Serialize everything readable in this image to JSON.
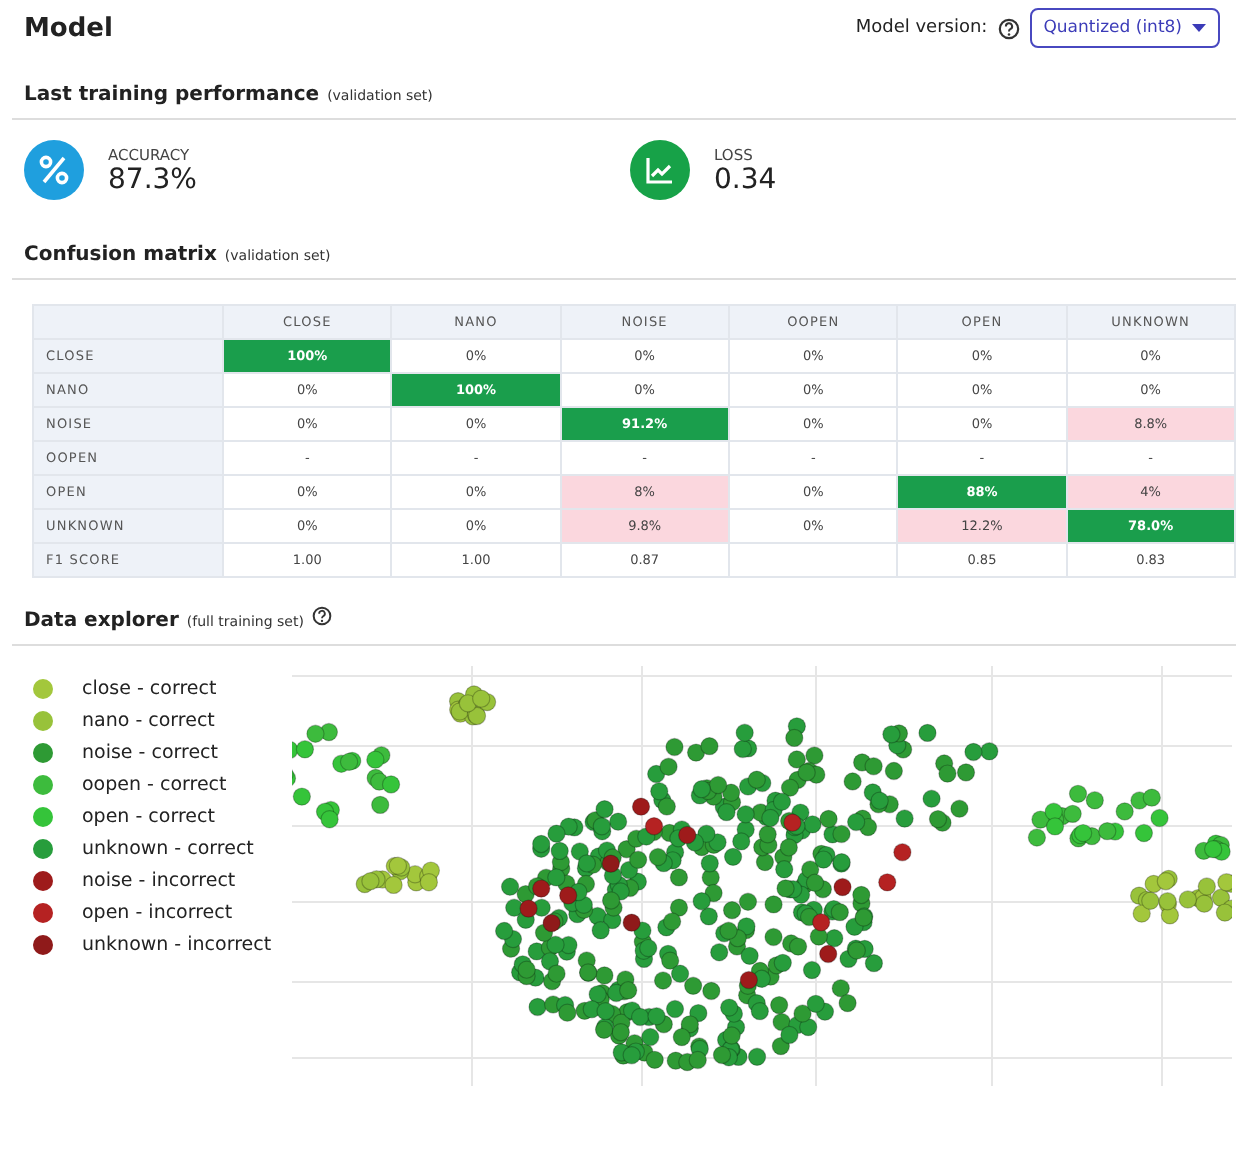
{
  "header": {
    "title": "Model",
    "version_label": "Model version:",
    "version_value": "Quantized (int8)"
  },
  "performance": {
    "title": "Last training performance",
    "subtitle": "(validation set)",
    "metrics": [
      {
        "kind": "accuracy",
        "label": "ACCURACY",
        "value": "87.3%"
      },
      {
        "kind": "loss",
        "label": "LOSS",
        "value": "0.34"
      }
    ]
  },
  "confusion": {
    "title": "Confusion matrix",
    "subtitle": "(validation set)",
    "columns": [
      "CLOSE",
      "NANO",
      "NOISE",
      "OOPEN",
      "OPEN",
      "UNKNOWN"
    ],
    "rows": [
      {
        "label": "CLOSE",
        "cells": [
          {
            "text": "100%",
            "kind": "correct"
          },
          {
            "text": "0%",
            "kind": "plain"
          },
          {
            "text": "0%",
            "kind": "plain"
          },
          {
            "text": "0%",
            "kind": "plain"
          },
          {
            "text": "0%",
            "kind": "plain"
          },
          {
            "text": "0%",
            "kind": "plain"
          }
        ]
      },
      {
        "label": "NANO",
        "cells": [
          {
            "text": "0%",
            "kind": "plain"
          },
          {
            "text": "100%",
            "kind": "correct"
          },
          {
            "text": "0%",
            "kind": "plain"
          },
          {
            "text": "0%",
            "kind": "plain"
          },
          {
            "text": "0%",
            "kind": "plain"
          },
          {
            "text": "0%",
            "kind": "plain"
          }
        ]
      },
      {
        "label": "NOISE",
        "cells": [
          {
            "text": "0%",
            "kind": "plain"
          },
          {
            "text": "0%",
            "kind": "plain"
          },
          {
            "text": "91.2%",
            "kind": "correct"
          },
          {
            "text": "0%",
            "kind": "plain"
          },
          {
            "text": "0%",
            "kind": "plain"
          },
          {
            "text": "8.8%",
            "kind": "error"
          }
        ]
      },
      {
        "label": "OOPEN",
        "cells": [
          {
            "text": "-",
            "kind": "plain"
          },
          {
            "text": "-",
            "kind": "plain"
          },
          {
            "text": "-",
            "kind": "plain"
          },
          {
            "text": "-",
            "kind": "plain"
          },
          {
            "text": "-",
            "kind": "plain"
          },
          {
            "text": "-",
            "kind": "plain"
          }
        ]
      },
      {
        "label": "OPEN",
        "cells": [
          {
            "text": "0%",
            "kind": "plain"
          },
          {
            "text": "0%",
            "kind": "plain"
          },
          {
            "text": "8%",
            "kind": "error"
          },
          {
            "text": "0%",
            "kind": "plain"
          },
          {
            "text": "88%",
            "kind": "correct"
          },
          {
            "text": "4%",
            "kind": "error"
          }
        ]
      },
      {
        "label": "UNKNOWN",
        "cells": [
          {
            "text": "0%",
            "kind": "plain"
          },
          {
            "text": "0%",
            "kind": "plain"
          },
          {
            "text": "9.8%",
            "kind": "error"
          },
          {
            "text": "0%",
            "kind": "plain"
          },
          {
            "text": "12.2%",
            "kind": "error"
          },
          {
            "text": "78.0%",
            "kind": "correct"
          }
        ]
      },
      {
        "label": "F1 SCORE",
        "cells": [
          {
            "text": "1.00",
            "kind": "plain"
          },
          {
            "text": "1.00",
            "kind": "plain"
          },
          {
            "text": "0.87",
            "kind": "plain"
          },
          {
            "kind": "plain"
          },
          {
            "text": "0.85",
            "kind": "plain"
          },
          {
            "text": "0.83",
            "kind": "plain"
          }
        ]
      }
    ]
  },
  "explorer": {
    "title": "Data explorer",
    "subtitle": "(full training set)",
    "legend": [
      {
        "label": "close - correct",
        "color": "#a3c73c"
      },
      {
        "label": "nano - correct",
        "color": "#98c23a"
      },
      {
        "label": "noise - correct",
        "color": "#2e9a34"
      },
      {
        "label": "oopen - correct",
        "color": "#3dbb3d"
      },
      {
        "label": "open - correct",
        "color": "#35c43a"
      },
      {
        "label": "unknown - correct",
        "color": "#279d3c"
      },
      {
        "label": "noise - incorrect",
        "color": "#9e1b1b"
      },
      {
        "label": "open - incorrect",
        "color": "#b52222"
      },
      {
        "label": "unknown - incorrect",
        "color": "#8f1a1a"
      }
    ]
  }
}
